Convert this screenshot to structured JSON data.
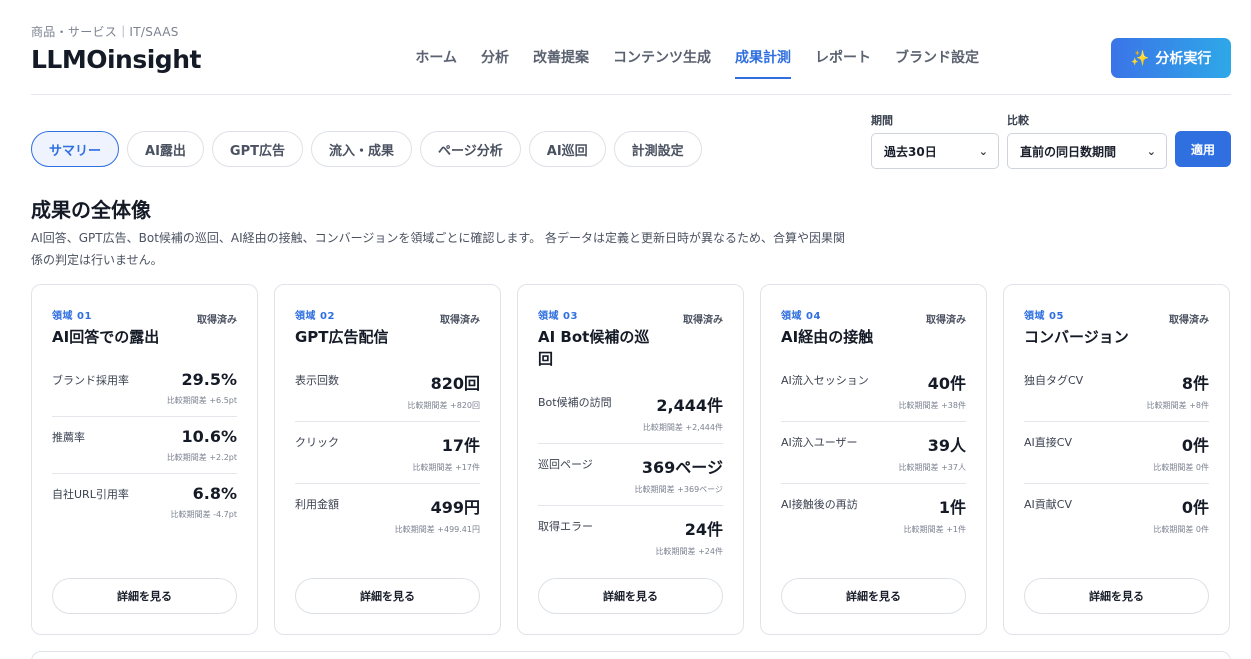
{
  "header": {
    "category": "商品・サービス｜IT/SAAS",
    "brand": "LLMOinsight",
    "nav": [
      {
        "label": "ホーム",
        "active": false
      },
      {
        "label": "分析",
        "active": false
      },
      {
        "label": "改善提案",
        "active": false
      },
      {
        "label": "コンテンツ生成",
        "active": false
      },
      {
        "label": "成果計測",
        "active": true
      },
      {
        "label": "レポート",
        "active": false
      },
      {
        "label": "ブランド設定",
        "active": false
      }
    ],
    "run_button": {
      "label": "分析実行",
      "icon": "sparkle-icon"
    }
  },
  "tabs": [
    {
      "label": "サマリー",
      "active": true
    },
    {
      "label": "AI露出",
      "active": false
    },
    {
      "label": "GPT広告",
      "active": false
    },
    {
      "label": "流入・成果",
      "active": false
    },
    {
      "label": "ページ分析",
      "active": false
    },
    {
      "label": "AI巡回",
      "active": false
    },
    {
      "label": "計測設定",
      "active": false
    }
  ],
  "filters": {
    "period": {
      "label": "期間",
      "value": "過去30日"
    },
    "compare": {
      "label": "比較",
      "value": "直前の同日数期間"
    },
    "apply_label": "適用"
  },
  "section": {
    "title": "成果の全体像",
    "description": "AI回答、GPT広告、Bot候補の巡回、AI経由の接触、コンバージョンを領域ごとに確認します。 各データは定義と更新日時が異なるため、合算や因果関係の判定は行いません。"
  },
  "cards": [
    {
      "domain": "領域 01",
      "title": "AI回答での露出",
      "status": "取得済み",
      "button": "詳細を見る",
      "metrics": [
        {
          "name": "ブランド採用率",
          "value": "29.5%",
          "delta": "比較期間差 +6.5pt"
        },
        {
          "name": "推薦率",
          "value": "10.6%",
          "delta": "比較期間差 +2.2pt"
        },
        {
          "name": "自社URL引用率",
          "value": "6.8%",
          "delta": "比較期間差 -4.7pt"
        }
      ]
    },
    {
      "domain": "領域 02",
      "title": "GPT広告配信",
      "status": "取得済み",
      "button": "詳細を見る",
      "metrics": [
        {
          "name": "表示回数",
          "value": "820回",
          "delta": "比較期間差 +820回"
        },
        {
          "name": "クリック",
          "value": "17件",
          "delta": "比較期間差 +17件"
        },
        {
          "name": "利用金額",
          "value": "499円",
          "delta": "比較期間差 +499.41円"
        }
      ]
    },
    {
      "domain": "領域 03",
      "title": "AI Bot候補の巡回",
      "status": "取得済み",
      "button": "詳細を見る",
      "metrics": [
        {
          "name": "Bot候補の訪問",
          "value": "2,444件",
          "delta": "比較期間差 +2,444件"
        },
        {
          "name": "巡回ページ",
          "value": "369ページ",
          "delta": "比較期間差 +369ページ"
        },
        {
          "name": "取得エラー",
          "value": "24件",
          "delta": "比較期間差 +24件"
        }
      ]
    },
    {
      "domain": "領域 04",
      "title": "AI経由の接触",
      "status": "取得済み",
      "button": "詳細を見る",
      "metrics": [
        {
          "name": "AI流入セッション",
          "value": "40件",
          "delta": "比較期間差 +38件"
        },
        {
          "name": "AI流入ユーザー",
          "value": "39人",
          "delta": "比較期間差 +37人"
        },
        {
          "name": "AI接触後の再訪",
          "value": "1件",
          "delta": "比較期間差 +1件"
        }
      ]
    },
    {
      "domain": "領域 05",
      "title": "コンバージョン",
      "status": "取得済み",
      "button": "詳細を見る",
      "metrics": [
        {
          "name": "独自タグCV",
          "value": "8件",
          "delta": "比較期間差 +8件"
        },
        {
          "name": "AI直接CV",
          "value": "0件",
          "delta": "比較期間差 0件"
        },
        {
          "name": "AI貢献CV",
          "value": "0件",
          "delta": "比較期間差 0件"
        }
      ]
    }
  ],
  "colors": {
    "accent": "#2f6fe0",
    "border": "#e0e4ea",
    "text": "#141a26"
  }
}
